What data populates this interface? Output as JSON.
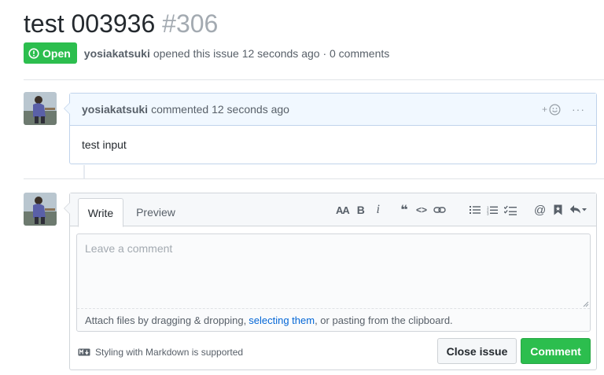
{
  "issue": {
    "title": "test 003936",
    "number": "#306",
    "state": "Open",
    "author": "yosiakatsuki",
    "meta_text": "opened this issue 12 seconds ago · 0 comments"
  },
  "comment": {
    "author": "yosiakatsuki",
    "header_text": "commented 12 seconds ago",
    "reaction_label": "+",
    "more_label": "···",
    "body": "test input"
  },
  "form": {
    "tabs": {
      "write": "Write",
      "preview": "Preview"
    },
    "toolbar": {
      "header": "AA",
      "bold": "B",
      "italic": "i",
      "quote": "❝",
      "code": "<>",
      "link": "link-icon",
      "ul": "bulleted-list-icon",
      "ol": "numbered-list-icon",
      "tasks": "task-list-icon",
      "mention": "@",
      "reference": "bookmark-icon",
      "reply": "reply-icon"
    },
    "placeholder": "Leave a comment",
    "value": "",
    "drag_hint_before": "Attach files by dragging & dropping,",
    "drag_hint_link": "selecting them",
    "drag_hint_after": ", or pasting from the clipboard.",
    "markdown_note": "Styling with Markdown is supported",
    "close_button": "Close issue",
    "comment_button": "Comment"
  },
  "colors": {
    "open_green": "#2cbe4e",
    "link_blue": "#0366d6",
    "comment_header_bg": "#f1f8ff"
  }
}
